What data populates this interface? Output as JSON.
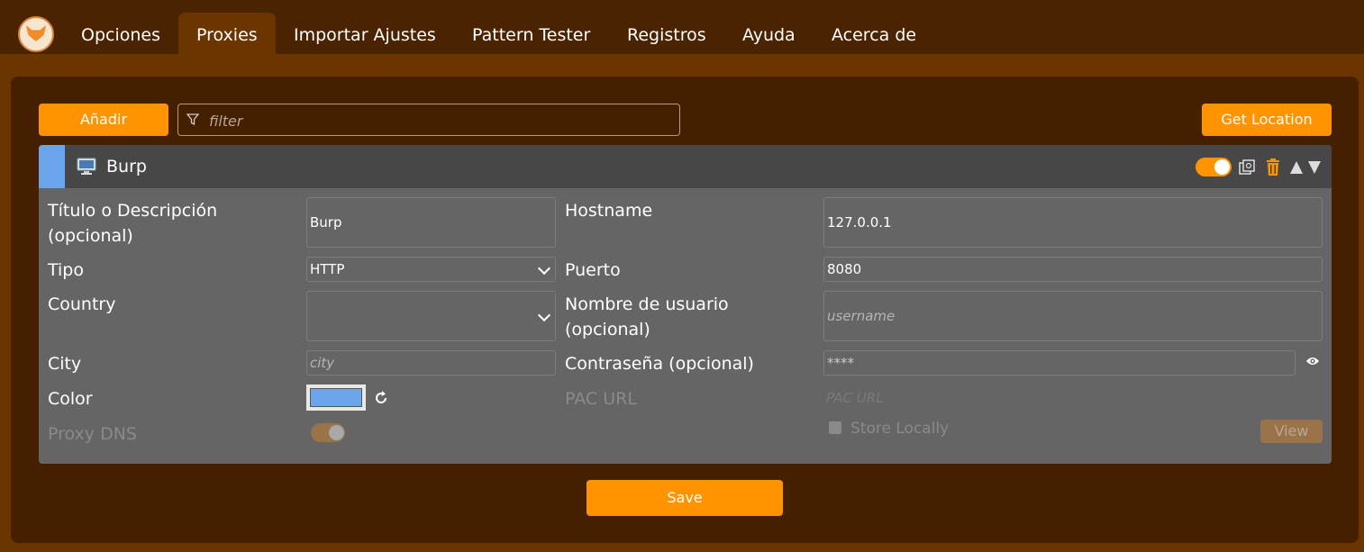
{
  "nav": {
    "tabs": [
      {
        "label": "Opciones",
        "active": false
      },
      {
        "label": "Proxies",
        "active": true
      },
      {
        "label": "Importar Ajustes",
        "active": false
      },
      {
        "label": "Pattern Tester",
        "active": false
      },
      {
        "label": "Registros",
        "active": false
      },
      {
        "label": "Ayuda",
        "active": false
      },
      {
        "label": "Acerca de",
        "active": false
      }
    ]
  },
  "toolbar": {
    "add_label": "Añadir",
    "filter_placeholder": "filter",
    "get_location_label": "Get Location"
  },
  "proxy": {
    "name": "Burp",
    "color": "#6aa4ec",
    "enabled": true,
    "title_label": "Título o Descripción (opcional)",
    "title_value": "Burp",
    "hostname_label": "Hostname",
    "hostname_value": "127.0.0.1",
    "type_label": "Tipo",
    "type_value": "HTTP",
    "port_label": "Puerto",
    "port_value": "8080",
    "country_label": "Country",
    "country_value": "",
    "username_label": "Nombre de usuario (opcional)",
    "username_placeholder": "username",
    "city_label": "City",
    "city_placeholder": "city",
    "password_label": "Contraseña (opcional)",
    "password_value": "****",
    "color_label": "Color",
    "pac_url_label": "PAC URL",
    "pac_url_placeholder": "PAC URL",
    "proxy_dns_label": "Proxy DNS",
    "proxy_dns_enabled": true,
    "store_locally_label": "Store Locally",
    "view_label": "View"
  },
  "footer": {
    "save_label": "Save"
  },
  "colors": {
    "accent": "#ff9400",
    "header_bg": "#4a2300",
    "band_bg": "#6b3500",
    "panel_bg": "#452000",
    "card_bg": "#656565",
    "card_header_bg": "#474747"
  }
}
